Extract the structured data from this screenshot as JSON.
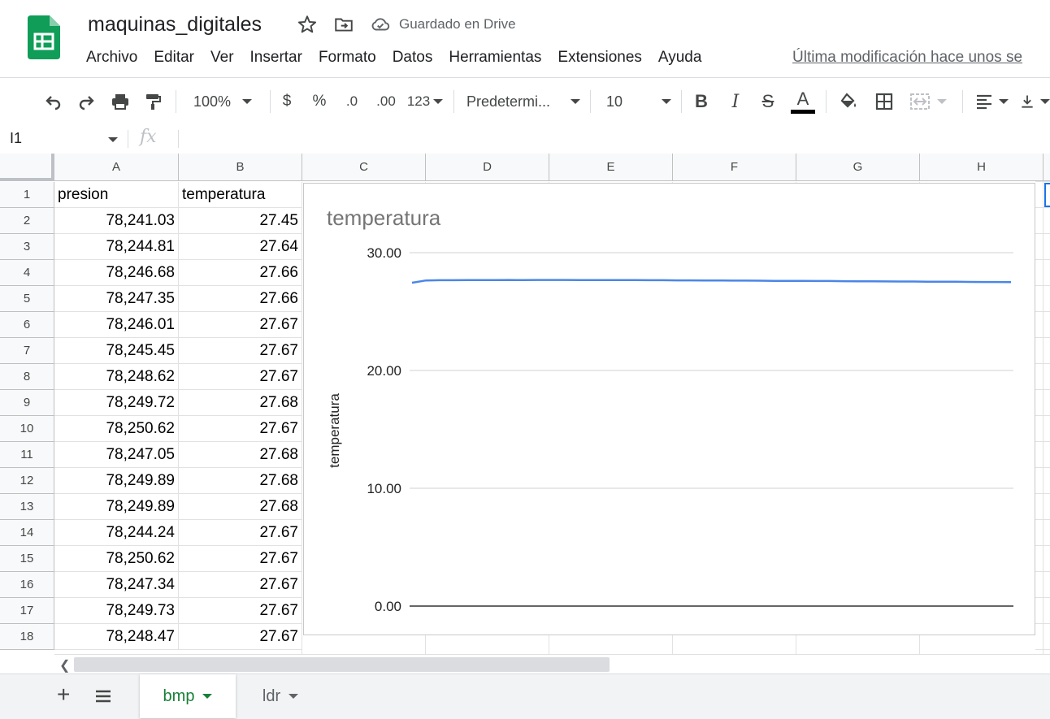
{
  "app": {
    "title": "maquinas_digitales",
    "saved_status": "Guardado en Drive",
    "last_edit": "Última modificación hace unos se",
    "menu": [
      "Archivo",
      "Editar",
      "Ver",
      "Insertar",
      "Formato",
      "Datos",
      "Herramientas",
      "Extensiones",
      "Ayuda"
    ]
  },
  "toolbar": {
    "zoom": "100%",
    "currency": "$",
    "percent": "%",
    "decrease_decimals": ".0",
    "increase_decimals": ".00",
    "more_formats": "123",
    "font": "Predetermi...",
    "font_size": "10",
    "bold": "B",
    "italic": "I",
    "strike": "S",
    "text_color": "A"
  },
  "formula_bar": {
    "name_box": "I1",
    "fx": "fx",
    "formula": ""
  },
  "grid": {
    "columns": [
      "A",
      "B",
      "C",
      "D",
      "E",
      "F",
      "G",
      "H"
    ],
    "row_numbers": [
      "1",
      "2",
      "3",
      "4",
      "5",
      "6",
      "7",
      "8",
      "9",
      "10",
      "11",
      "12",
      "13",
      "14",
      "15",
      "16",
      "17",
      "18"
    ],
    "header_row": [
      "presion",
      "temperatura"
    ],
    "rows": [
      [
        "78,241.03",
        "27.45"
      ],
      [
        "78,244.81",
        "27.64"
      ],
      [
        "78,246.68",
        "27.66"
      ],
      [
        "78,247.35",
        "27.66"
      ],
      [
        "78,246.01",
        "27.67"
      ],
      [
        "78,245.45",
        "27.67"
      ],
      [
        "78,248.62",
        "27.67"
      ],
      [
        "78,249.72",
        "27.68"
      ],
      [
        "78,250.62",
        "27.67"
      ],
      [
        "78,247.05",
        "27.68"
      ],
      [
        "78,249.89",
        "27.68"
      ],
      [
        "78,249.89",
        "27.68"
      ],
      [
        "78,244.24",
        "27.67"
      ],
      [
        "78,250.62",
        "27.67"
      ],
      [
        "78,247.34",
        "27.67"
      ],
      [
        "78,249.73",
        "27.67"
      ],
      [
        "78,248.47",
        "27.67"
      ]
    ]
  },
  "chart_data": {
    "type": "line",
    "title": "temperatura",
    "xlabel": "",
    "ylabel": "temperatura",
    "ylim": [
      0,
      30
    ],
    "yticks": [
      "0.00",
      "10.00",
      "20.00",
      "30.00"
    ],
    "grid": true,
    "series": [
      {
        "name": "temperatura",
        "color": "#4a86e8",
        "values": [
          27.45,
          27.64,
          27.66,
          27.66,
          27.67,
          27.67,
          27.67,
          27.68,
          27.67,
          27.68,
          27.68,
          27.68,
          27.67,
          27.67,
          27.67,
          27.67,
          27.67,
          27.66,
          27.66,
          27.65,
          27.65,
          27.64,
          27.64,
          27.63,
          27.63,
          27.62,
          27.61,
          27.61,
          27.6,
          27.59,
          27.59,
          27.58,
          27.57,
          27.57,
          27.56,
          27.55,
          27.55,
          27.54,
          27.53,
          27.53,
          27.52,
          27.51,
          27.51,
          27.5
        ]
      }
    ]
  },
  "sheets": {
    "tabs": [
      "bmp",
      "ldr"
    ],
    "active": "bmp"
  },
  "colors": {
    "sheets_green": "#0f9d58",
    "active_tab_text": "#188038",
    "line": "#4a86e8"
  }
}
